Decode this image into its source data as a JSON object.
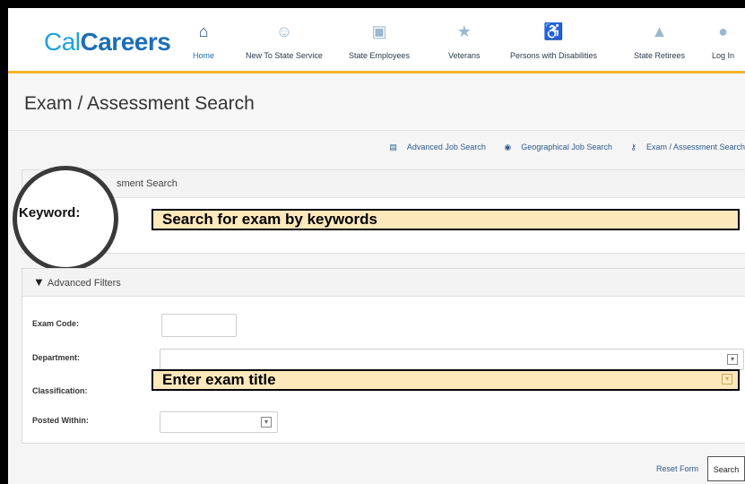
{
  "nav": {
    "logo_cal": "Cal",
    "logo_careers": "Careers",
    "items": [
      {
        "label": "Home",
        "icon": "home-icon",
        "glyph": "🏠"
      },
      {
        "label": "New To State Service",
        "icon": "handshake-icon",
        "glyph": "☺"
      },
      {
        "label": "State Employees",
        "icon": "badge-icon",
        "glyph": "▣"
      },
      {
        "label": "Veterans",
        "icon": "star-icon",
        "glyph": "★"
      },
      {
        "label": "Persons with Disabilities",
        "icon": "wheelchair-icon",
        "glyph": "♿"
      },
      {
        "label": "State Retirees",
        "icon": "capitol-icon",
        "glyph": "⌂"
      },
      {
        "label": "Log In",
        "icon": "user-icon",
        "glyph": "●"
      }
    ]
  },
  "page_title": "Exam / Assessment Search",
  "quick_links": {
    "advanced": "Advanced Job Search",
    "geo": "Geographical Job Search",
    "exam": "Exam / Assessment Search"
  },
  "panel1": {
    "title": "Exam / Assessment Search",
    "title_visible": "sment Search"
  },
  "callouts": {
    "keyword": "Keyword:",
    "keyword_text": "Search for exam by keywords",
    "classification_text": "Enter exam title"
  },
  "filters": {
    "title": "Advanced Filters",
    "exam_code_label": "Exam Code:",
    "department_label": "Department:",
    "classification_label": "Classification:",
    "posted_within_label": "Posted Within:"
  },
  "footer": {
    "reset": "Reset Form",
    "search": "Search"
  }
}
